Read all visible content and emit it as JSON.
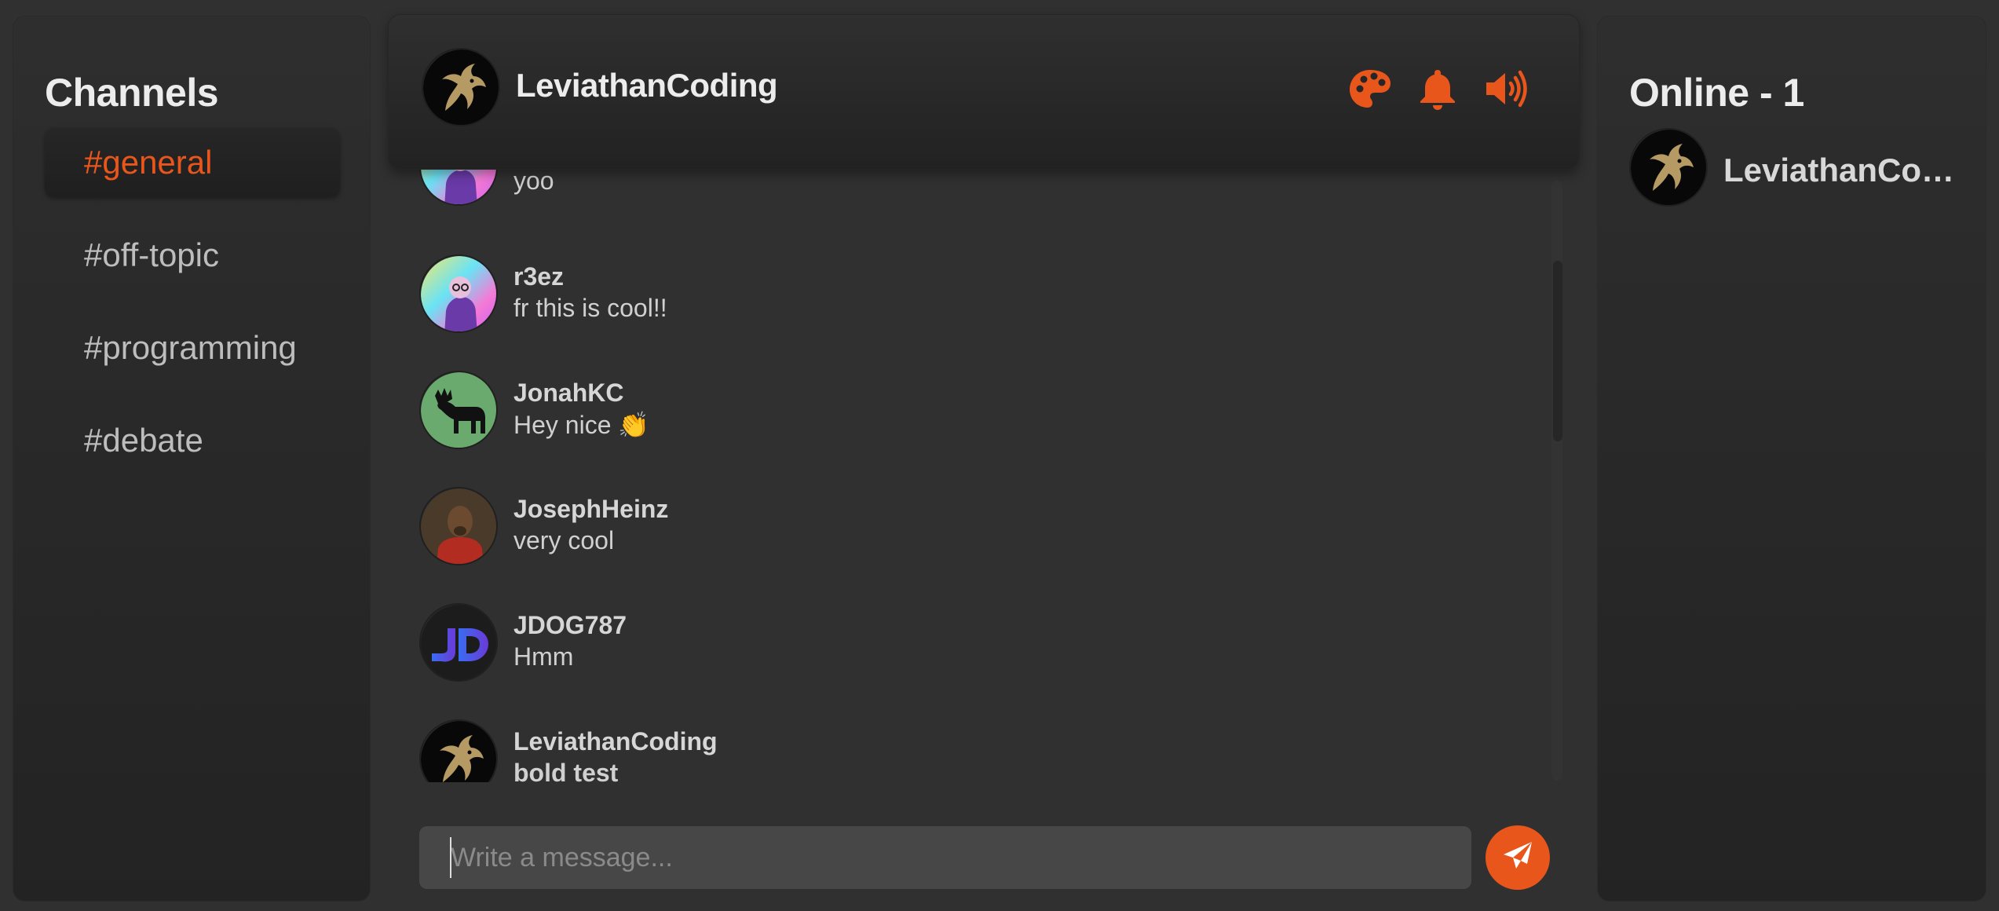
{
  "channels": {
    "title": "Channels",
    "items": [
      {
        "label": "#general",
        "active": true
      },
      {
        "label": "#off-topic",
        "active": false
      },
      {
        "label": "#programming",
        "active": false
      },
      {
        "label": "#debate",
        "active": false
      }
    ]
  },
  "header": {
    "username": "LeviathanCoding",
    "icons": [
      "palette-icon",
      "bell-icon",
      "volume-icon"
    ]
  },
  "messages": [
    {
      "author": "",
      "text": "yoo",
      "avatar": "r3ez-avatar"
    },
    {
      "author": "r3ez",
      "text": "fr this is cool!!",
      "avatar": "r3ez-avatar"
    },
    {
      "author": "JonahKC",
      "text": "Hey nice 👏",
      "avatar": "moose-avatar"
    },
    {
      "author": "JosephHeinz",
      "text": "very cool",
      "avatar": "dog-portrait-avatar"
    },
    {
      "author": "JDOG787",
      "text": "Hmm",
      "avatar": "jd-logo-avatar"
    },
    {
      "author": "LeviathanCoding",
      "text": "bold test",
      "avatar": "dragon-avatar"
    }
  ],
  "composer": {
    "placeholder": "Write a message..."
  },
  "online": {
    "title": "Online - 1",
    "users": [
      {
        "name": "LeviathanCoding"
      }
    ]
  },
  "colors": {
    "accent": "#e8561c",
    "background": "#303030",
    "panel": "#2a2a2a"
  }
}
